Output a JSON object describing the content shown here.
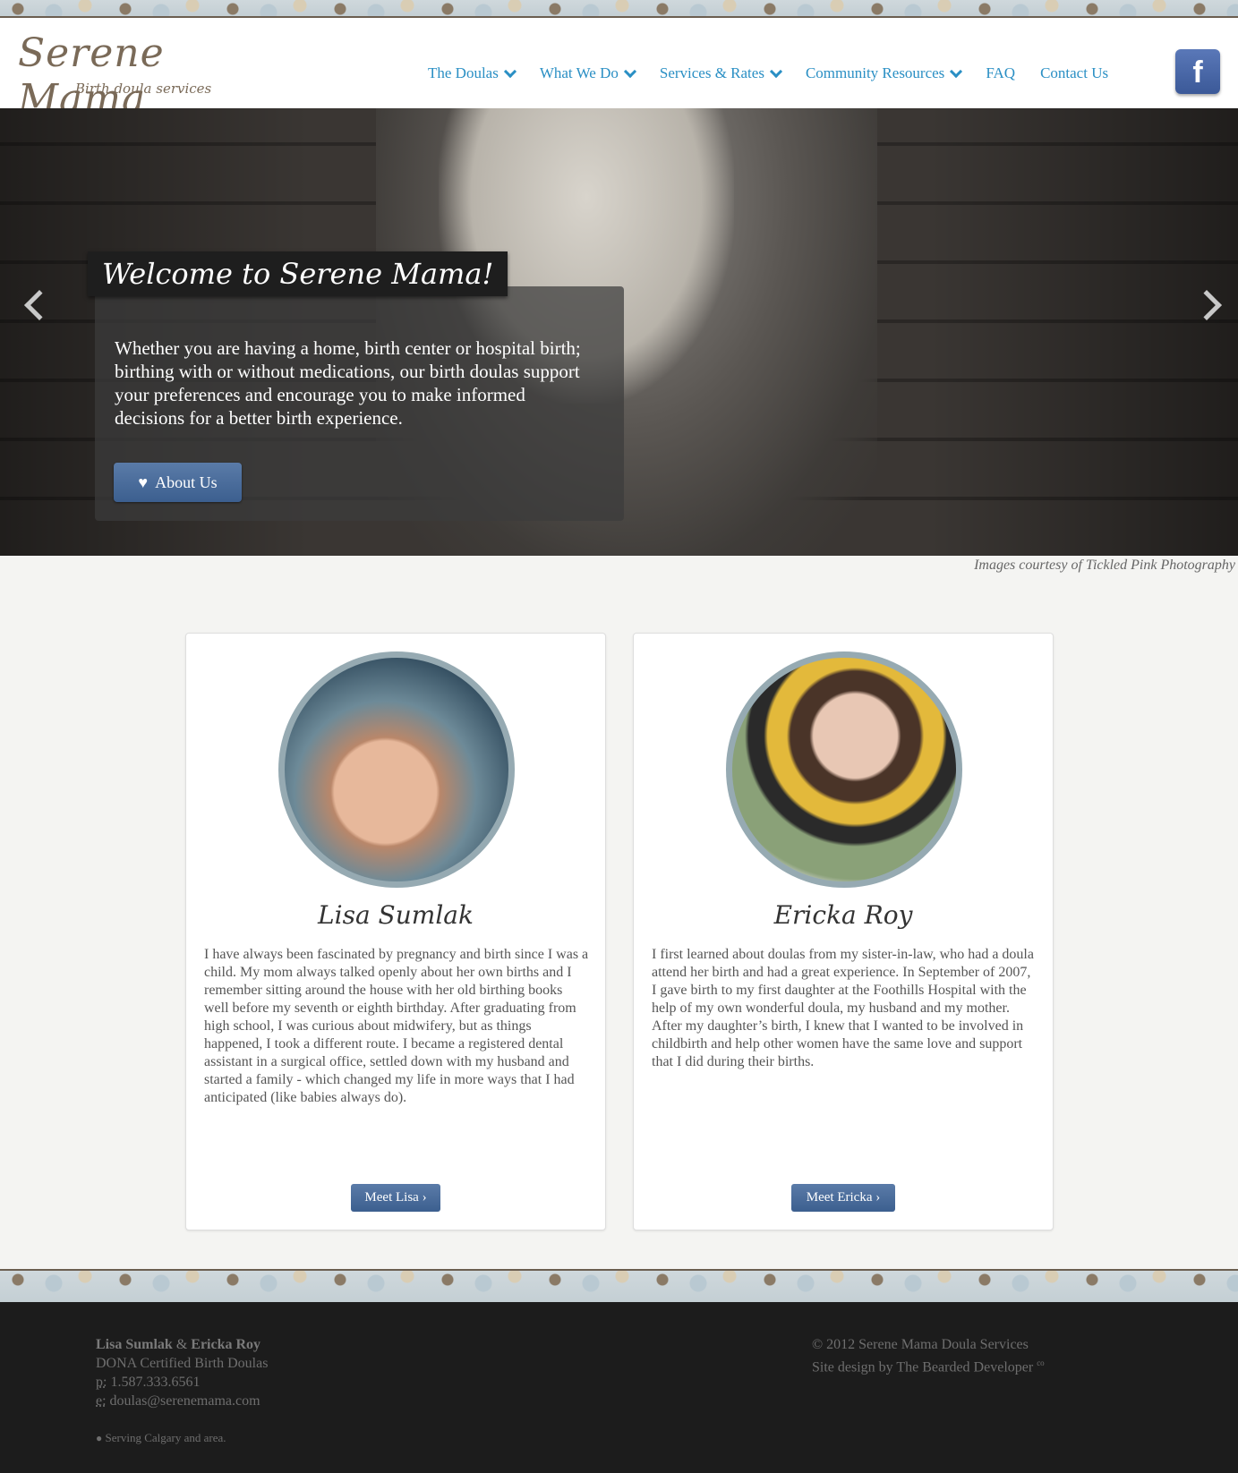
{
  "header": {
    "logo_title": "Serene Mama",
    "logo_subtitle": "Birth doula services",
    "nav": [
      {
        "label": "The Doulas",
        "dropdown": true
      },
      {
        "label": "What We Do",
        "dropdown": true
      },
      {
        "label": "Services & Rates",
        "dropdown": true
      },
      {
        "label": "Community Resources",
        "dropdown": true
      },
      {
        "label": "FAQ",
        "dropdown": false
      },
      {
        "label": "Contact Us",
        "dropdown": false
      }
    ],
    "facebook_icon": "facebook-icon",
    "facebook_label": "f",
    "nav_color": "#2a8fc4"
  },
  "hero": {
    "welcome": "Welcome to Serene Mama!",
    "caption": "Whether you are having a home, birth center or hospital birth; birthing with or without medications, our birth doulas support your preferences and encourage you to make informed decisions for a better birth experience.",
    "button_label": "About Us",
    "button_icon": "heart-icon",
    "credit": "Images courtesy of Tickled Pink Photography"
  },
  "doulas": [
    {
      "name": "Lisa Sumlak",
      "bio": "I have always been fascinated by pregnancy and birth since I was a child. My mom always talked openly about her own births and I remember sitting around the house with her old birthing books well before my seventh or eighth birthday. After graduating from high school, I was curious about midwifery, but as things happened, I took a different route. I became a registered dental assistant in a surgical office, settled down with my husband and started a family - which changed my life in more ways that I had anticipated (like babies always do).",
      "button": "Meet Lisa ›"
    },
    {
      "name": "Ericka Roy",
      "bio": "I first learned about doulas from my sister-in-law, who had a doula attend her birth and had a great experience. In September of 2007, I gave birth to my first daughter at the Foothills Hospital with the help of my own wonderful doula, my husband and my mother. After my daughter’s birth, I knew that I wanted to be involved in childbirth and help other women have the same love and support that I did during their births.",
      "button": "Meet Ericka ›"
    }
  ],
  "footer": {
    "name1": "Lisa Sumlak",
    "amp": "&",
    "name2": "Ericka Roy",
    "certification": "DONA Certified Birth Doulas",
    "phone_label": "p:",
    "phone": "1.587.333.6561",
    "email_label": "e:",
    "email": "doulas@serenemama.com",
    "serving_icon": "globe-icon",
    "serving": "Serving Calgary and area.",
    "copyright": "© 2012 Serene Mama Doula Services",
    "design_prefix": "Site design by ",
    "designer": "The Bearded Developer",
    "designer_sup": "co"
  },
  "colors": {
    "button": "#3c5f8f",
    "avatar_ring": "#96aab2",
    "footer_bg": "#1c1c1c"
  }
}
